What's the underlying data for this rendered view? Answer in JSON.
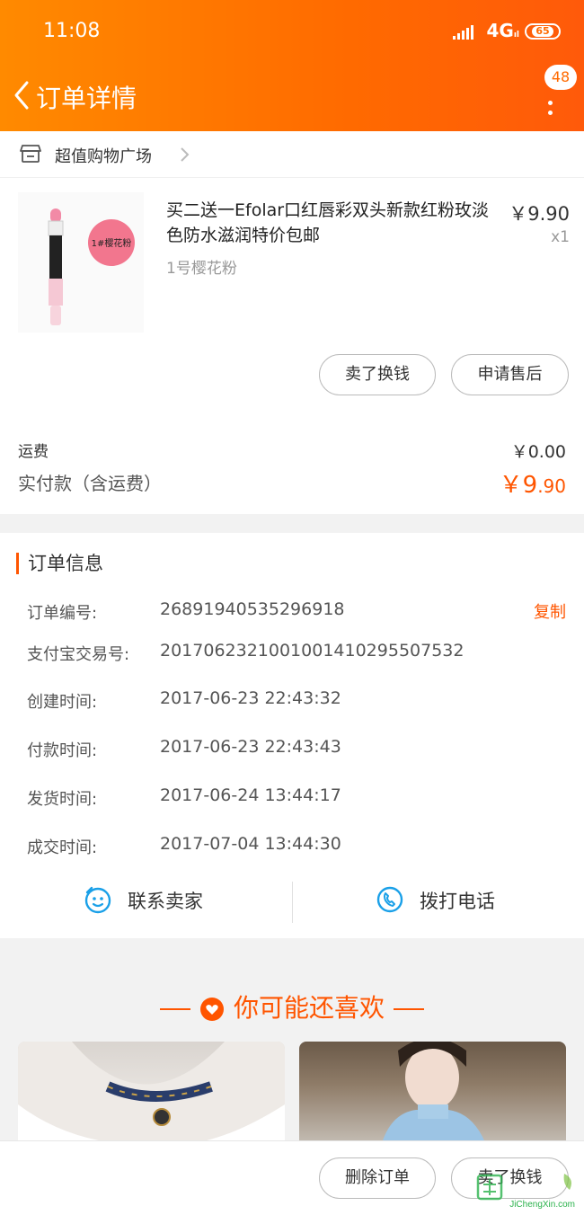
{
  "status_bar": {
    "time": "11:08",
    "network": "4G",
    "network_sub": "ıl",
    "battery": "65"
  },
  "nav": {
    "title": "订单详情",
    "badge": "48"
  },
  "shop": {
    "name": "超值购物广场"
  },
  "product": {
    "title": "买二送一Efolar口红唇彩双头新款红粉玫淡色防水滋润特价包邮",
    "sku": "1号樱花粉",
    "price": "￥9.90",
    "qty": "x1",
    "img_label": "1#樱花粉",
    "buttons": {
      "sell": "卖了换钱",
      "after_sale": "申请售后"
    }
  },
  "payment": {
    "fee_label": "运费",
    "fee_value": "￥0.00",
    "paid_label": "实付款（含运费）",
    "paid_currency_int": "￥9",
    "paid_decimal": ".90"
  },
  "order_info": {
    "heading": "订单信息",
    "copy_label": "复制",
    "rows": [
      {
        "label": "订单编号:",
        "value": "26891940535296918"
      },
      {
        "label": "支付宝交易号:",
        "value": "2017062321001001410295507532"
      },
      {
        "label": "创建时间:",
        "value": "2017-06-23 22:43:32"
      },
      {
        "label": "付款时间:",
        "value": "2017-06-23 22:43:43"
      },
      {
        "label": "发货时间:",
        "value": "2017-06-24 13:44:17"
      },
      {
        "label": "成交时间:",
        "value": "2017-07-04 13:44:30"
      }
    ],
    "contact_seller": "联系卖家",
    "call_phone": "拨打电话"
  },
  "recommend": {
    "title": "你可能还喜欢"
  },
  "bottom_bar": {
    "delete_order": "删除订单",
    "sell": "卖了换钱"
  },
  "watermark": {
    "text": "JiChengXin.com"
  },
  "colors": {
    "accent": "#ff5500",
    "header_start": "#ff8a00",
    "header_end": "#ff5a0a"
  }
}
